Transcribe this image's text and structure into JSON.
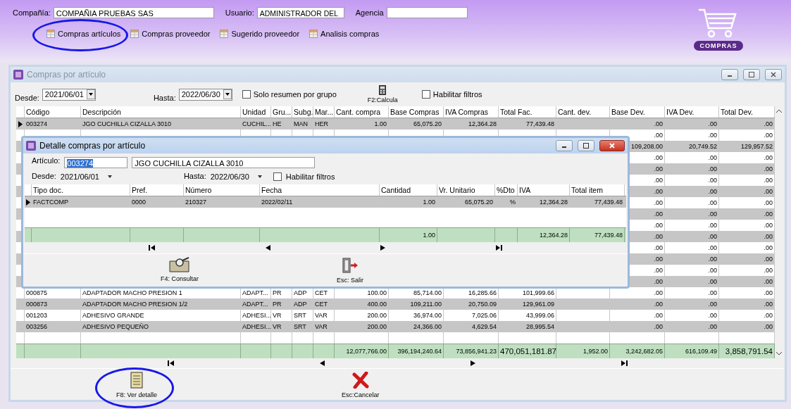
{
  "header": {
    "company_label": "Compañía:",
    "company": "COMPAÑIA PRUEBAS SAS",
    "user_label": "Usuario:",
    "user": "ADMINISTRADOR DEL",
    "agency_label": "Agencia"
  },
  "toolbar": [
    {
      "label": "Compras artículos",
      "circled": true
    },
    {
      "label": "Compras proveedor",
      "circled": false
    },
    {
      "label": "Sugerido proveedor",
      "circled": false
    },
    {
      "label": "Analisis compras",
      "circled": false
    }
  ],
  "logo": {
    "label": "COMPRAS"
  },
  "window": {
    "title": "Compras por artículo",
    "active": false,
    "from_label": "Desde:",
    "from": "2021/06/01",
    "to_label": "Hasta:",
    "to": "2022/06/30",
    "summary": {
      "label": "Solo resumen por grupo",
      "checked": false
    },
    "calc": {
      "label": "F2:Calcula"
    },
    "filters": {
      "label": "Habilitar filtros",
      "checked": false
    },
    "table": {
      "columns": [
        "Código",
        "Descripción",
        "Unidad",
        "Gru...",
        "Subg.",
        "Mar...",
        "Cant. compra",
        "Base Compras",
        "IVA Compras",
        "Total Fac.",
        "Cant. dev.",
        "Base Dev.",
        "IVA Dev.",
        "Total Dev."
      ],
      "rows": [
        {
          "selected": true,
          "cells": [
            "003274",
            "JGO CUCHILLA CIZALLA 3010",
            "CUCHIL...",
            "HE",
            "MAN",
            "HER",
            "1.00",
            "65,075.20",
            "12,364.28",
            "77,439.48"
          ],
          "dev_cells": [
            ".00",
            ".00",
            ".00"
          ]
        },
        {
          "selected": false,
          "dev_cells": [
            ".00",
            ".00",
            ".00"
          ]
        },
        {
          "selected": false,
          "dev_cells": [
            "109,208.00",
            "20,749.52",
            "129,957.52"
          ]
        },
        {
          "selected": false,
          "dev_cells": [
            ".00",
            ".00",
            ".00"
          ]
        },
        {
          "selected": false,
          "dev_cells": [
            ".00",
            ".00",
            ".00"
          ]
        },
        {
          "selected": false,
          "dev_cells": [
            ".00",
            ".00",
            ".00"
          ]
        },
        {
          "selected": false,
          "dev_cells": [
            ".00",
            ".00",
            ".00"
          ]
        },
        {
          "selected": false,
          "dev_cells": [
            ".00",
            ".00",
            ".00"
          ]
        },
        {
          "selected": false,
          "dev_cells": [
            ".00",
            ".00",
            ".00"
          ]
        },
        {
          "selected": false,
          "dev_cells": [
            ".00",
            ".00",
            ".00"
          ]
        },
        {
          "selected": false,
          "dev_cells": [
            ".00",
            ".00",
            ".00"
          ]
        },
        {
          "selected": false,
          "dev_cells": [
            ".00",
            ".00",
            ".00"
          ]
        },
        {
          "selected": false,
          "dev_cells": [
            ".00",
            ".00",
            ".00"
          ]
        },
        {
          "selected": false,
          "dev_cells": [
            ".00",
            ".00",
            ".00"
          ]
        },
        {
          "selected": false,
          "dev_cells": [
            ".00",
            ".00",
            ".00"
          ]
        },
        {
          "selected": false,
          "cells": [
            "000875",
            "ADAPTADOR MACHO PRESION 1",
            "ADAPT...",
            "PR",
            "ADP",
            "CET",
            "100.00",
            "85,714.00",
            "16,285.66",
            "101,999.66"
          ],
          "dev_cells": [
            ".00",
            ".00",
            ".00"
          ]
        },
        {
          "selected": false,
          "cells": [
            "000873",
            "ADAPTADOR MACHO PRESION 1/2",
            "ADAPT...",
            "PR",
            "ADP",
            "CET",
            "400.00",
            "109,211.00",
            "20,750.09",
            "129,961.09"
          ],
          "dev_cells": [
            ".00",
            ".00",
            ".00"
          ]
        },
        {
          "selected": false,
          "cells": [
            "001203",
            "ADHESIVO GRANDE",
            "ADHESI...",
            "VR",
            "SRT",
            "VAR",
            "200.00",
            "36,974.00",
            "7,025.06",
            "43,999.06"
          ],
          "dev_cells": [
            ".00",
            ".00",
            ".00"
          ]
        },
        {
          "selected": false,
          "cells": [
            "003256",
            "ADHESIVO PEQUEÑO",
            "ADHESI...",
            "VR",
            "SRT",
            "VAR",
            "200.00",
            "24,366.00",
            "4,629.54",
            "28,995.54"
          ],
          "dev_cells": [
            ".00",
            ".00",
            ".00"
          ]
        },
        {
          "selected": false
        }
      ],
      "totals": {
        "qty": "12,077,766.00",
        "base": "396,194,240.64",
        "iva": "73,856,941.23",
        "total": "470,051,181.87",
        "qty_dev": "1,952.00",
        "base_dev": "3,242,682.05",
        "iva_dev": "616,109.49",
        "total_dev": "3,858,791.54"
      }
    },
    "buttons": [
      {
        "label": "F8: Ver detalle",
        "circled": true
      },
      {
        "label": "Esc:Cancelar",
        "circled": false
      }
    ]
  },
  "dialog": {
    "title": "Detalle compras por artículo",
    "article_label": "Artículo:",
    "article_code": "003274",
    "code_selected": true,
    "article_name": "JGO CUCHILLA CIZALLA 3010",
    "from_label": "Desde:",
    "from": "2021/06/01",
    "to_label": "Hasta:",
    "to": "2022/06/30",
    "filters": {
      "label": "Habilitar filtros",
      "checked": false
    },
    "table": {
      "columns": [
        "Tipo doc.",
        "Pref.",
        "Número",
        "Fecha",
        "Cantidad",
        "Vr. Unitario",
        "%Dto",
        "IVA",
        "Total item"
      ],
      "rows": [
        {
          "selected": true,
          "cells": [
            "FACTCOMP",
            "0000",
            "210327",
            "2022/02/11",
            "1.00",
            "65,075.20",
            "%",
            "12,364.28",
            "77,439.48"
          ]
        }
      ],
      "totals": {
        "quantity": "1.00",
        "iva": "12,364.28",
        "total_item": "77,439.48"
      }
    },
    "buttons": [
      {
        "label": "F4: Consultar"
      },
      {
        "label": "Esc: Salir"
      }
    ]
  }
}
